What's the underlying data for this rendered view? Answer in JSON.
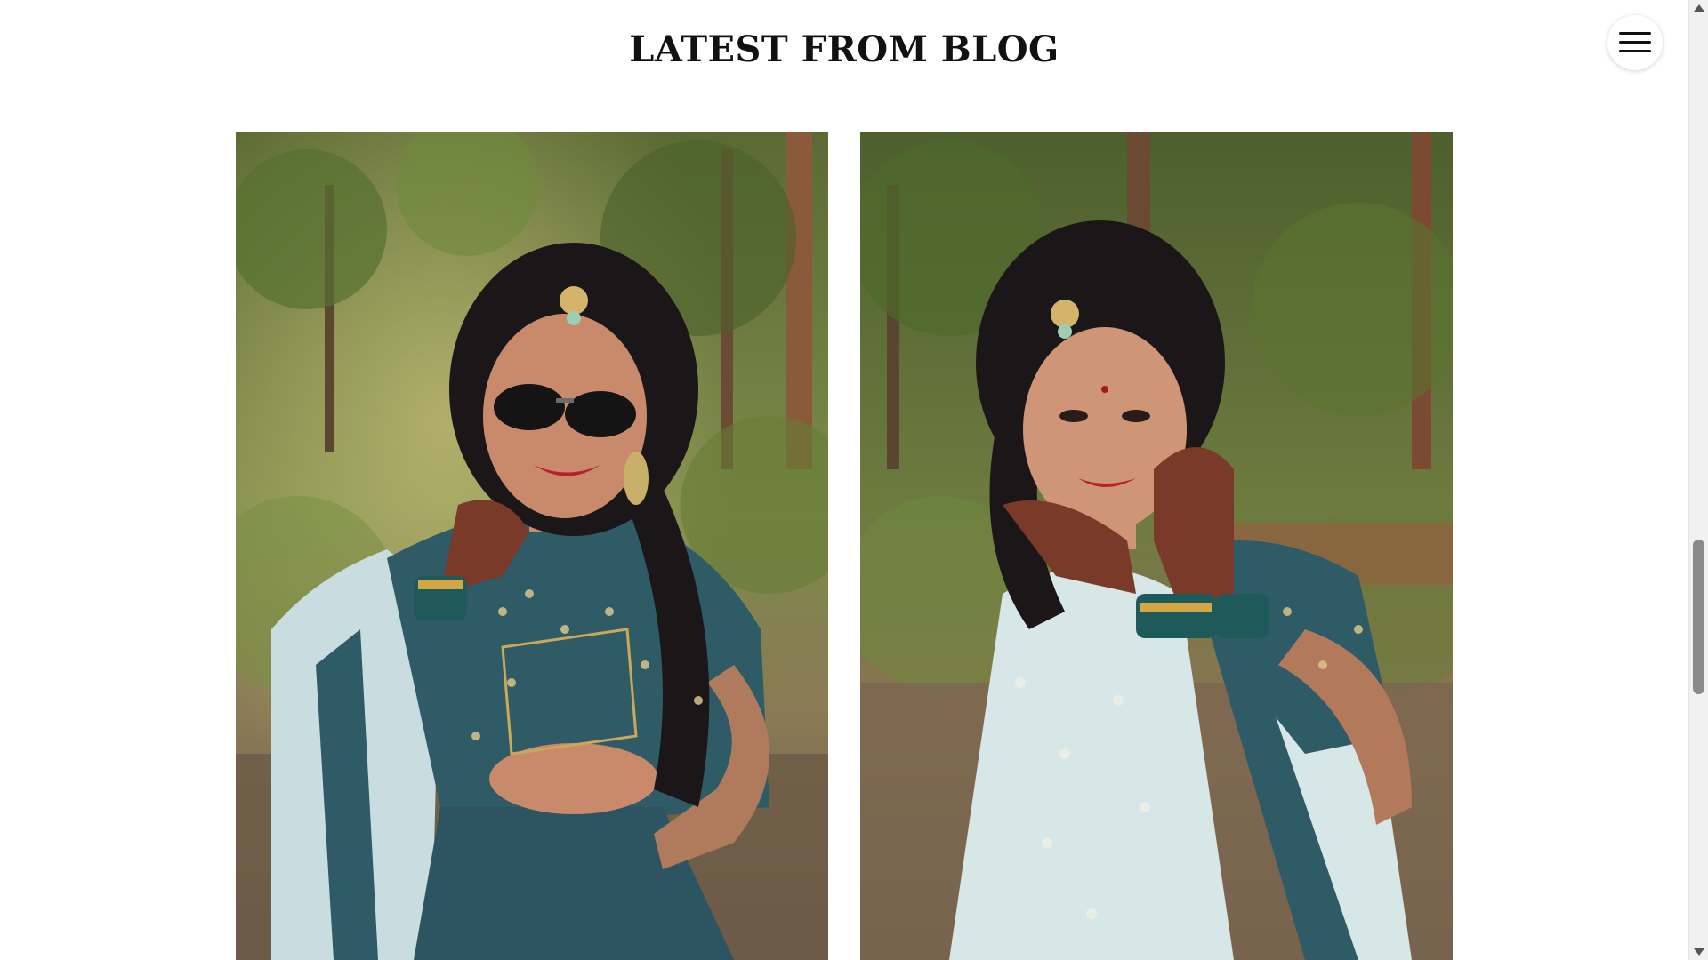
{
  "section": {
    "title": "LATEST FROM BLOG"
  },
  "menu": {
    "icon": "hamburger-icon"
  },
  "blog_posts": [
    {
      "image_icon": "bride-portrait-sunglasses",
      "palette": {
        "foliage": "#6e7d3e",
        "dress": "#2f5b66",
        "dupatta": "#c9dcdf",
        "skin": "#c98a6c",
        "hair": "#1b1718"
      }
    },
    {
      "image_icon": "bride-portrait-hands",
      "palette": {
        "foliage": "#5f6f3a",
        "dress": "#2f5b66",
        "dupatta": "#d7e6e6",
        "skin": "#cf9577",
        "hair": "#1b1718"
      }
    }
  ],
  "scrollbar": {
    "position_fraction": 0.56
  }
}
